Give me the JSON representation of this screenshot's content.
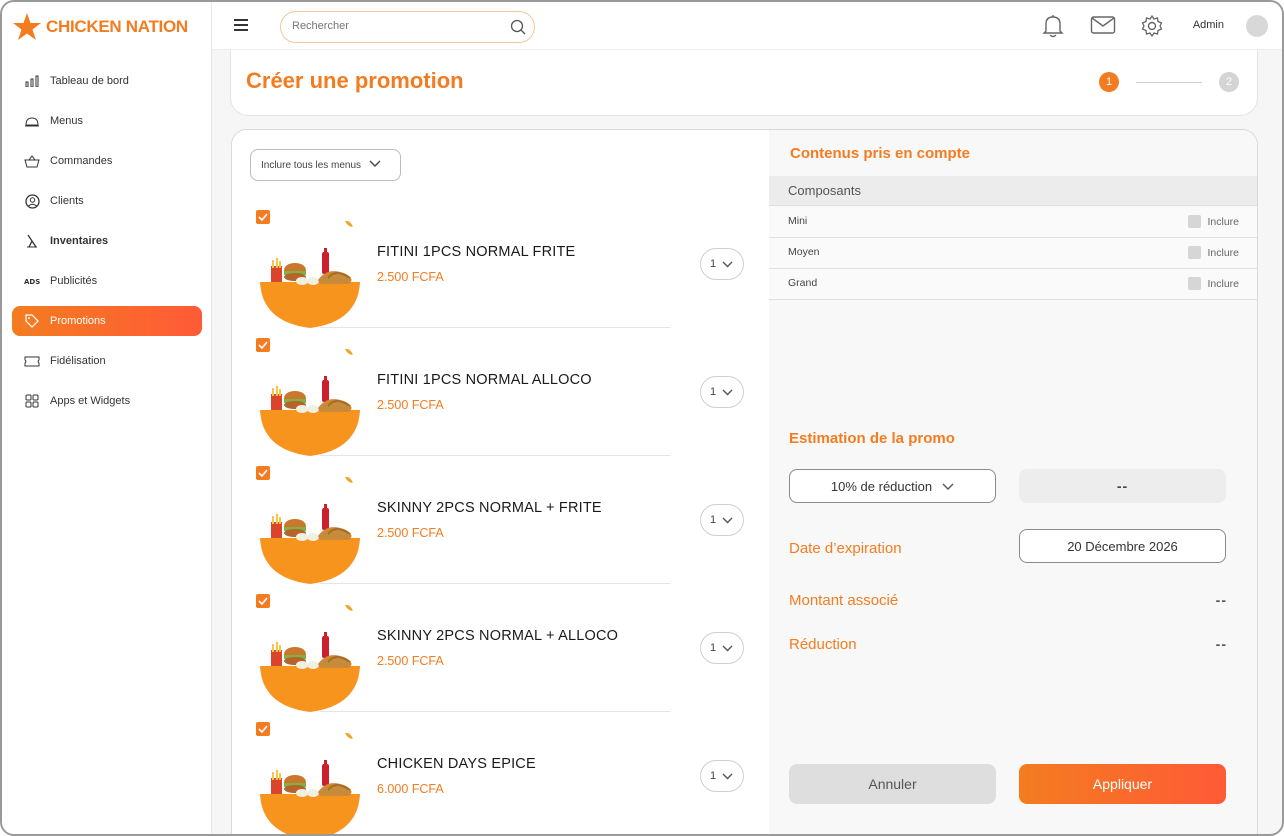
{
  "brand": {
    "name": "CHICKEN NATION",
    "color": "#f47c20"
  },
  "header": {
    "search_placeholder": "Rechercher",
    "user": "Admin"
  },
  "sidebar": {
    "items": [
      {
        "label": "Tableau de bord",
        "icon": "bar-chart-icon"
      },
      {
        "label": "Menus",
        "icon": "cloche-icon"
      },
      {
        "label": "Commandes",
        "icon": "basket-icon"
      },
      {
        "label": "Clients",
        "icon": "user-circle-icon"
      },
      {
        "label": "Inventaires",
        "icon": "inventory-icon"
      },
      {
        "label": "Publicités",
        "icon": "ads-icon"
      },
      {
        "label": "Promotions",
        "icon": "tag-icon",
        "active": true
      },
      {
        "label": "Fidélisation",
        "icon": "ticket-icon"
      },
      {
        "label": "Apps et Widgets",
        "icon": "grid-icon"
      }
    ]
  },
  "page": {
    "title": "Créer une promotion",
    "steps": [
      "1",
      "2"
    ],
    "current_step": 1
  },
  "left": {
    "filter_label": "Inclure tous les menus",
    "items": [
      {
        "name": "FITINI 1PCS NORMAL FRITE",
        "price": "2.500 FCFA",
        "qty": "1",
        "checked": true
      },
      {
        "name": "FITINI 1PCS NORMAL ALLOCO",
        "price": "2.500 FCFA",
        "qty": "1",
        "checked": true
      },
      {
        "name": "SKINNY 2PCS NORMAL + FRITE",
        "price": "2.500 FCFA",
        "qty": "1",
        "checked": true
      },
      {
        "name": "SKINNY 2PCS NORMAL + ALLOCO",
        "price": "2.500 FCFA",
        "qty": "1",
        "checked": true
      },
      {
        "name": "CHICKEN DAYS EPICE",
        "price": "6.000 FCFA",
        "qty": "1",
        "checked": true
      }
    ]
  },
  "right": {
    "contents_title": "Contenus pris en compte",
    "components_header": "Composants",
    "include_label": "Inclure",
    "components": [
      "Mini",
      "Moyen",
      "Grand"
    ],
    "estimate_title": "Estimation de la promo",
    "discount_option": "10% de réduction",
    "estimate_value": "--",
    "expiry_label": "Date d’expiration",
    "expiry_date": "20 Décembre 2026",
    "amount_label": "Montant associé",
    "amount_value": "--",
    "reduction_label": "Réduction",
    "reduction_value": "--",
    "cancel_label": "Annuler",
    "apply_label": "Appliquer"
  }
}
